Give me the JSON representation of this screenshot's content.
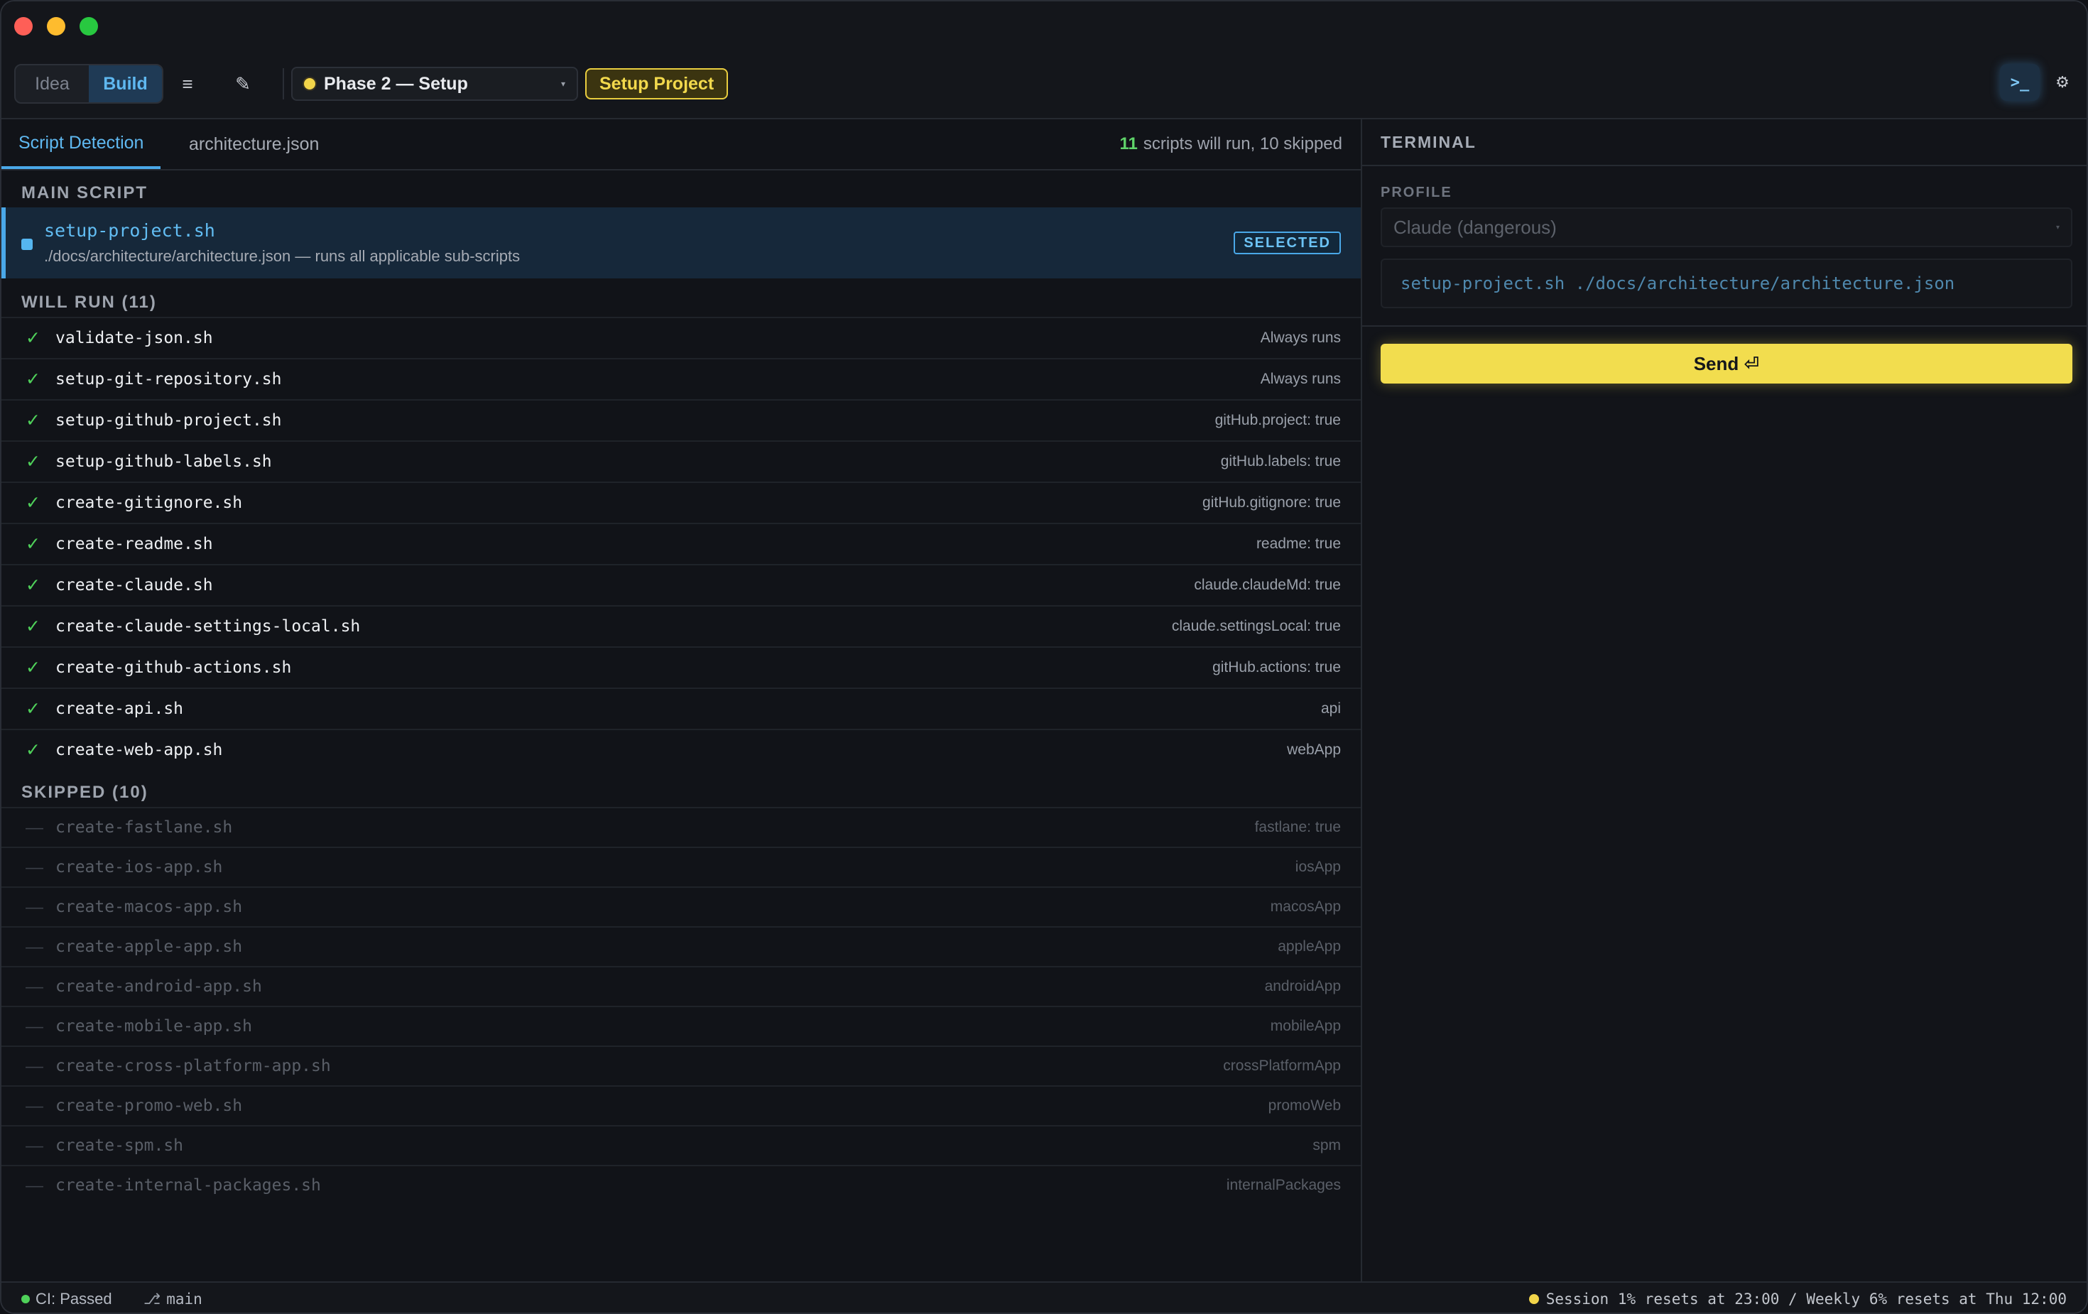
{
  "toolbar": {
    "modes": [
      "Idea",
      "Build"
    ],
    "active_mode": "Build",
    "list_icon": "≡",
    "edit_icon": "✎",
    "phase": "Phase 2 — Setup",
    "action_button": "Setup Project",
    "terminal_icon": ">_",
    "settings_icon": "⚙"
  },
  "tabs": {
    "items": [
      "Script Detection",
      "architecture.json"
    ],
    "active": "Script Detection",
    "summary_count": "11",
    "summary_text": "scripts will run, 10 skipped"
  },
  "main_script": {
    "section_label": "MAIN SCRIPT",
    "name": "setup-project.sh",
    "description": "./docs/architecture/architecture.json — runs all applicable sub-scripts",
    "badge": "SELECTED"
  },
  "will_run": {
    "section_label": "WILL RUN (11)",
    "check_mark": "✓",
    "items": [
      {
        "name": "validate-json.sh",
        "condition": "Always runs"
      },
      {
        "name": "setup-git-repository.sh",
        "condition": "Always runs"
      },
      {
        "name": "setup-github-project.sh",
        "condition": "gitHub.project: true"
      },
      {
        "name": "setup-github-labels.sh",
        "condition": "gitHub.labels: true"
      },
      {
        "name": "create-gitignore.sh",
        "condition": "gitHub.gitignore: true"
      },
      {
        "name": "create-readme.sh",
        "condition": "readme: true"
      },
      {
        "name": "create-claude.sh",
        "condition": "claude.claudeMd: true"
      },
      {
        "name": "create-claude-settings-local.sh",
        "condition": "claude.settingsLocal: true"
      },
      {
        "name": "create-github-actions.sh",
        "condition": "gitHub.actions: true"
      },
      {
        "name": "create-api.sh",
        "condition": "api"
      },
      {
        "name": "create-web-app.sh",
        "condition": "webApp"
      }
    ]
  },
  "skipped": {
    "section_label": "SKIPPED (10)",
    "dash_mark": "—",
    "items": [
      {
        "name": "create-fastlane.sh",
        "condition": "fastlane: true"
      },
      {
        "name": "create-ios-app.sh",
        "condition": "iosApp"
      },
      {
        "name": "create-macos-app.sh",
        "condition": "macosApp"
      },
      {
        "name": "create-apple-app.sh",
        "condition": "appleApp"
      },
      {
        "name": "create-android-app.sh",
        "condition": "androidApp"
      },
      {
        "name": "create-mobile-app.sh",
        "condition": "mobileApp"
      },
      {
        "name": "create-cross-platform-app.sh",
        "condition": "crossPlatformApp"
      },
      {
        "name": "create-promo-web.sh",
        "condition": "promoWeb"
      },
      {
        "name": "create-spm.sh",
        "condition": "spm"
      },
      {
        "name": "create-internal-packages.sh",
        "condition": "internalPackages"
      }
    ]
  },
  "terminal": {
    "title": "TERMINAL",
    "profile_label": "PROFILE",
    "profile_value": "Claude (dangerous)",
    "command": "setup-project.sh ./docs/architecture/architecture.json",
    "send_label": "Send ⏎"
  },
  "status": {
    "ci": "CI: Passed",
    "branch_icon": "⎇",
    "branch": "main",
    "session": "Session 1% resets at 23:00 / Weekly 6% resets at Thu 12:00"
  },
  "colors": {
    "accent": "#4aa8e8",
    "action": "#f2dd4e",
    "success": "#4fd15a"
  }
}
